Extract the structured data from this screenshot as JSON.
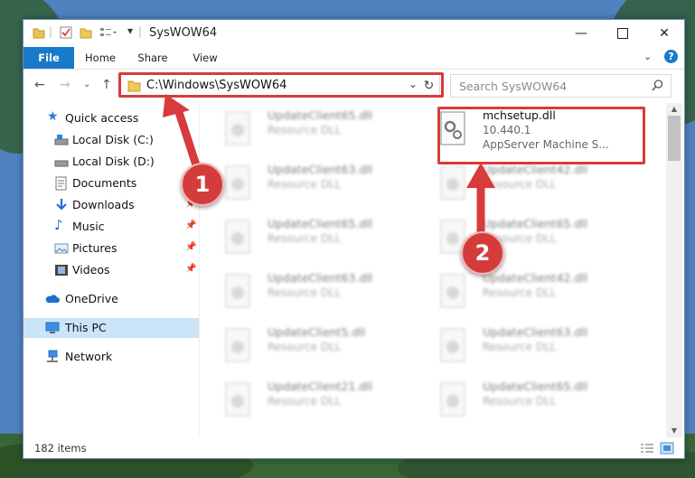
{
  "window": {
    "title": "SysWOW64",
    "minimize_icon": "minimize-icon",
    "maximize_icon": "maximize-icon",
    "close_icon": "close-icon"
  },
  "ribbon": {
    "tabs": [
      {
        "label": "File"
      },
      {
        "label": "Home"
      },
      {
        "label": "Share"
      },
      {
        "label": "View"
      }
    ]
  },
  "nav": {
    "address": "C:\\Windows\\SysWOW64",
    "search_placeholder": "Search SysWOW64"
  },
  "sidebar": {
    "items": [
      {
        "label": "Quick access",
        "icon": "star-icon"
      },
      {
        "label": "Local Disk (C:)",
        "icon": "drive-icon"
      },
      {
        "label": "Local Disk (D:)",
        "icon": "drive-icon"
      },
      {
        "label": "Documents",
        "icon": "documents-icon"
      },
      {
        "label": "Downloads",
        "icon": "downloads-icon"
      },
      {
        "label": "Music",
        "icon": "music-icon"
      },
      {
        "label": "Pictures",
        "icon": "pictures-icon"
      },
      {
        "label": "Videos",
        "icon": "videos-icon"
      },
      {
        "label": "OneDrive",
        "icon": "cloud-icon"
      },
      {
        "label": "This PC",
        "icon": "computer-icon"
      },
      {
        "label": "Network",
        "icon": "network-icon"
      }
    ]
  },
  "files": {
    "highlighted": {
      "name": "mchsetup.dll",
      "version": "10.440.1",
      "description": "AppServer Machine S..."
    },
    "left_column": [
      {
        "name": "UpdateClient65.dll",
        "type": "Resource DLL"
      },
      {
        "name": "UpdateClient63.dll",
        "type": "Resource DLL"
      },
      {
        "name": "UpdateClient65.dll",
        "type": "Resource DLL"
      },
      {
        "name": "UpdateClient63.dll",
        "type": "Resource DLL"
      },
      {
        "name": "UpdateClient5.dll",
        "type": "Resource DLL"
      },
      {
        "name": "UpdateClient21.dll",
        "type": "Resource DLL"
      }
    ],
    "right_column": [
      {
        "name": "UpdateClient42.dll",
        "type": "Resource DLL"
      },
      {
        "name": "UpdateClient65.dll",
        "type": "Resource DLL"
      },
      {
        "name": "UpdateClient42.dll",
        "type": "Resource DLL"
      },
      {
        "name": "UpdateClient63.dll",
        "type": "Resource DLL"
      },
      {
        "name": "UpdateClient65.dll",
        "type": "Resource DLL"
      }
    ]
  },
  "status": {
    "count": "182 items"
  },
  "annotations": {
    "badge1": "1",
    "badge2": "2",
    "accent": "#d83b3b"
  }
}
